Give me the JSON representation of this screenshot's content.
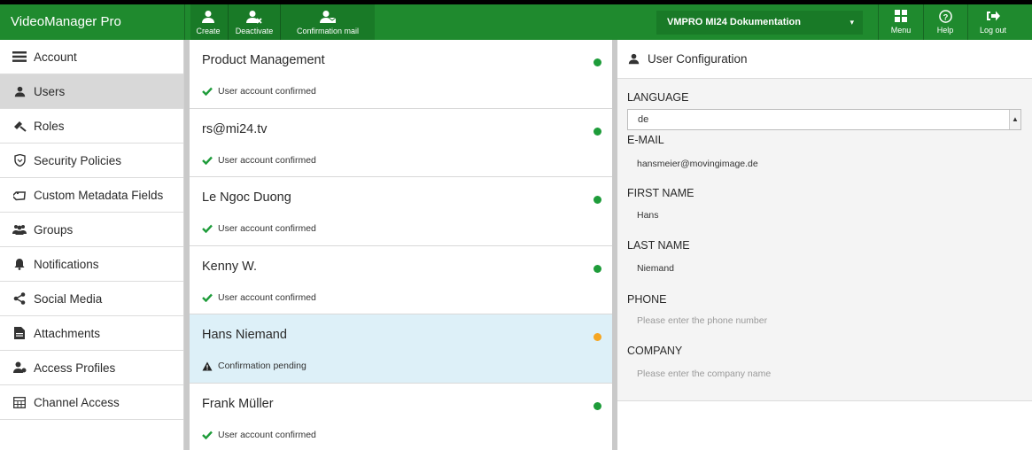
{
  "app": {
    "title": "VideoManager Pro"
  },
  "toolbar": {
    "create": "Create",
    "deactivate": "Deactivate",
    "confirmation_mail": "Confirmation mail",
    "project": "VMPRO MI24 Dokumentation",
    "menu": "Menu",
    "help": "Help",
    "logout": "Log out"
  },
  "sidebar": {
    "items": [
      {
        "label": "Account",
        "icon": "account-icon"
      },
      {
        "label": "Users",
        "icon": "user-icon",
        "active": true
      },
      {
        "label": "Roles",
        "icon": "roles-icon"
      },
      {
        "label": "Security Policies",
        "icon": "shield-icon"
      },
      {
        "label": "Custom Metadata Fields",
        "icon": "tag-icon"
      },
      {
        "label": "Groups",
        "icon": "groups-icon"
      },
      {
        "label": "Notifications",
        "icon": "bell-icon"
      },
      {
        "label": "Social Media",
        "icon": "share-icon"
      },
      {
        "label": "Attachments",
        "icon": "file-icon"
      },
      {
        "label": "Access Profiles",
        "icon": "access-profile-icon"
      },
      {
        "label": "Channel Access",
        "icon": "channel-icon"
      }
    ]
  },
  "users": [
    {
      "name": "Product Management",
      "status": "User account confirmed",
      "state": "confirmed"
    },
    {
      "name": "rs@mi24.tv",
      "status": "User account confirmed",
      "state": "confirmed"
    },
    {
      "name": "Le Ngoc Duong",
      "status": "User account confirmed",
      "state": "confirmed"
    },
    {
      "name": "Kenny W.",
      "status": "User account confirmed",
      "state": "confirmed"
    },
    {
      "name": "Hans Niemand",
      "status": "Confirmation pending",
      "state": "pending",
      "selected": true
    },
    {
      "name": "Frank Müller",
      "status": "User account confirmed",
      "state": "confirmed"
    }
  ],
  "config": {
    "title": "User Configuration",
    "language_label": "LANGUAGE",
    "language_value": "de",
    "email_label": "E-MAIL",
    "email_value": "hansmeier@movingimage.de",
    "first_name_label": "FIRST NAME",
    "first_name_value": "Hans",
    "last_name_label": "LAST NAME",
    "last_name_value": "Niemand",
    "phone_label": "PHONE",
    "phone_placeholder": "Please enter the phone number",
    "company_label": "COMPANY",
    "company_placeholder": "Please enter the company name"
  },
  "colors": {
    "brand": "#1f8a2e",
    "confirmed": "#1e9c3a",
    "pending": "#f5a623",
    "selected_row": "#ddf0f8"
  }
}
